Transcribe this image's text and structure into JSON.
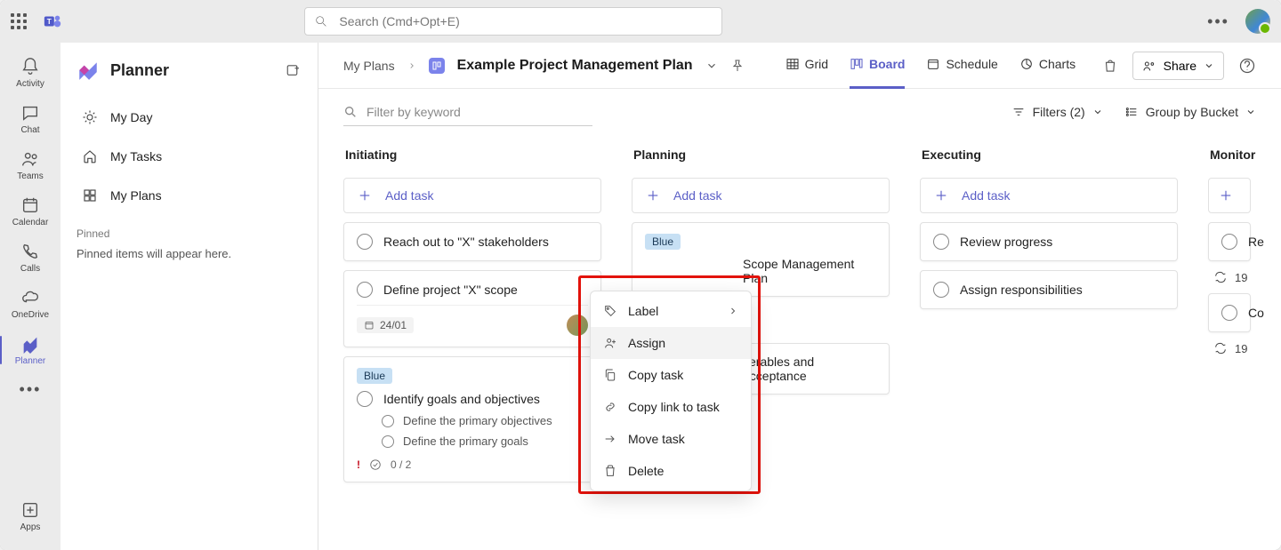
{
  "topbar": {
    "search_placeholder": "Search (Cmd+Opt+E)"
  },
  "rail": {
    "items": [
      {
        "label": "Activity"
      },
      {
        "label": "Chat"
      },
      {
        "label": "Teams"
      },
      {
        "label": "Calendar"
      },
      {
        "label": "Calls"
      },
      {
        "label": "OneDrive"
      },
      {
        "label": "Planner"
      },
      {
        "label": ""
      },
      {
        "label": "Apps"
      }
    ]
  },
  "sidebar": {
    "title": "Planner",
    "nav": {
      "myday": "My Day",
      "mytasks": "My Tasks",
      "myplans": "My Plans"
    },
    "pinned_label": "Pinned",
    "pinned_empty": "Pinned items will appear here."
  },
  "header": {
    "breadcrumb": "My Plans",
    "plan_title": "Example Project Management Plan",
    "views": {
      "grid": "Grid",
      "board": "Board",
      "schedule": "Schedule",
      "charts": "Charts"
    },
    "share": "Share"
  },
  "toolbar": {
    "filter_placeholder": "Filter by keyword",
    "filters_label": "Filters (2)",
    "group_label": "Group by Bucket"
  },
  "board": {
    "add_task": "Add task",
    "columns": [
      {
        "title": "Initiating",
        "cards": [
          {
            "type": "simple",
            "title": "Reach out to \"X\" stakeholders"
          },
          {
            "type": "withdate",
            "title": "Define project \"X\" scope",
            "date": "24/01"
          },
          {
            "type": "complex",
            "label": "Blue",
            "title": "Identify goals and objectives",
            "subs": [
              "Define the primary objectives",
              "Define the primary goals"
            ],
            "progress": "0 / 2"
          }
        ]
      },
      {
        "title": "Planning",
        "cards": [
          {
            "type": "withlabel",
            "label": "Blue",
            "title": "Scope Management Plan"
          },
          {
            "type": "simple",
            "title": "verables and acceptance"
          }
        ]
      },
      {
        "title": "Executing",
        "cards": [
          {
            "type": "simple",
            "title": "Review progress"
          },
          {
            "type": "simple",
            "title": "Assign responsibilities"
          }
        ]
      },
      {
        "title": "Monitor",
        "cards": [
          {
            "type": "simple",
            "title": "Re"
          },
          {
            "type": "recur",
            "text": "19"
          },
          {
            "type": "simple",
            "title": "Co"
          },
          {
            "type": "recur",
            "text": "19"
          }
        ]
      }
    ]
  },
  "context_menu": {
    "label": "Label",
    "assign": "Assign",
    "copy_task": "Copy task",
    "copy_link": "Copy link to task",
    "move": "Move task",
    "delete": "Delete"
  }
}
